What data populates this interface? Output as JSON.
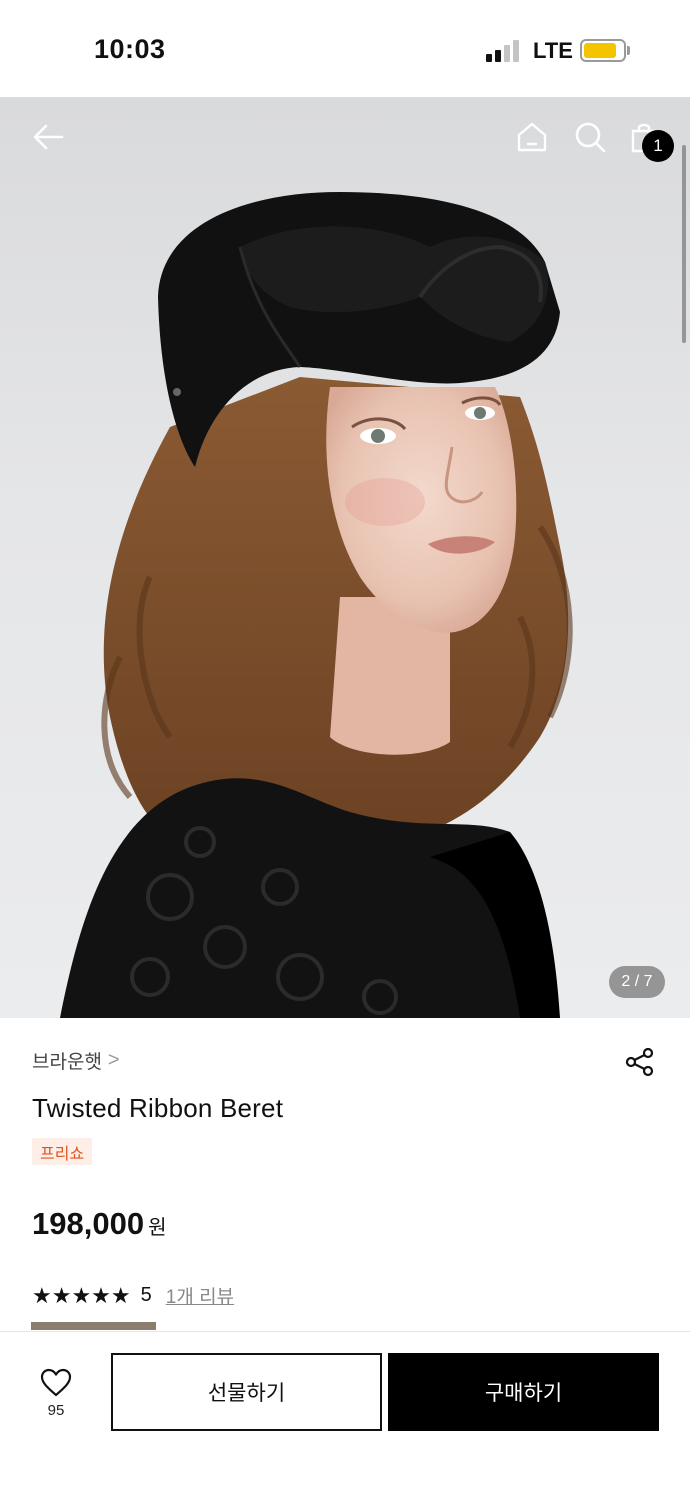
{
  "status_bar": {
    "time": "10:03",
    "network": "LTE",
    "battery_level": 0.85,
    "battery_color": "#f5c400"
  },
  "header": {
    "back_icon": "arrow-left-icon",
    "home_icon": "home-icon",
    "search_icon": "search-icon",
    "cart_icon": "shopping-bag-icon",
    "cart_count": "1"
  },
  "gallery": {
    "page_indicator": "2 / 7",
    "current_index": 2,
    "total": 7
  },
  "product": {
    "brand": "브라운햇",
    "brand_chevron": ">",
    "title": "Twisted Ribbon Beret",
    "tag": "프리쇼",
    "price": "198,000",
    "currency": "원",
    "stars": "★★★★★",
    "rating": "5",
    "review_link": "1개 리뷰"
  },
  "actions": {
    "wishlist_count": "95",
    "gift_label": "선물하기",
    "buy_label": "구매하기",
    "accent": "#000000",
    "tag_color": "#e2531e"
  }
}
